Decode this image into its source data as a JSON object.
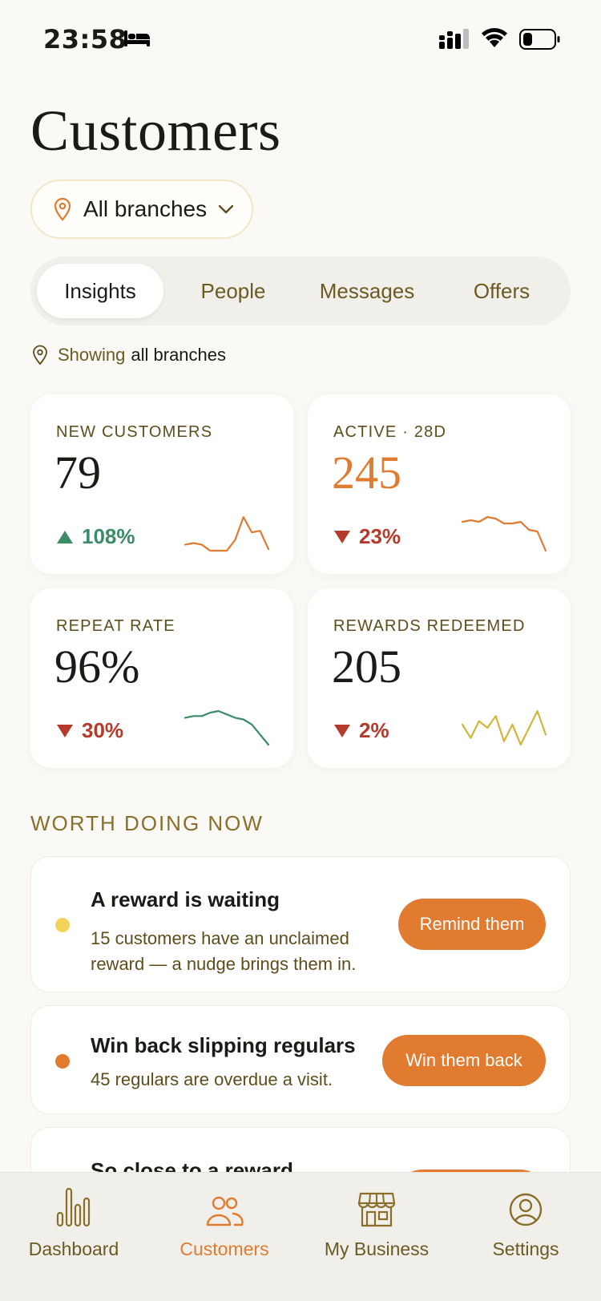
{
  "status_bar": {
    "time": "23:58",
    "icons": [
      "bed-icon",
      "signal-icon",
      "wifi-icon",
      "battery-icon"
    ]
  },
  "header": {
    "title": "Customers"
  },
  "branch_selector": {
    "value": "All branches",
    "icon": "location-pin-icon"
  },
  "tabs": [
    {
      "label": "Insights",
      "active": true
    },
    {
      "label": "People",
      "active": false
    },
    {
      "label": "Messages",
      "active": false
    },
    {
      "label": "Offers",
      "active": false
    }
  ],
  "showing": {
    "prefix": "Showing",
    "scope": "all branches"
  },
  "metrics": [
    {
      "label": "NEW CUSTOMERS",
      "value": "79",
      "delta": "108%",
      "direction": "up",
      "color": "#E07B30",
      "trend": [
        9,
        10,
        9,
        5,
        5,
        5,
        12,
        27,
        17,
        18,
        6
      ]
    },
    {
      "label": "ACTIVE · 28D",
      "value": "245",
      "delta": "23%",
      "direction": "down",
      "color": "#E07B30",
      "trend": [
        24,
        25,
        24,
        27,
        26,
        23,
        23,
        24,
        19,
        18,
        6
      ]
    },
    {
      "label": "REPEAT RATE",
      "value": "96%",
      "delta": "30%",
      "direction": "down",
      "color": "#3C8C68",
      "trend": [
        22,
        23,
        23,
        25,
        26,
        24,
        22,
        21,
        18,
        12,
        6
      ]
    },
    {
      "label": "REWARDS REDEEMED",
      "value": "205",
      "delta": "2%",
      "direction": "down",
      "color": "#D3B43C",
      "trend": [
        20,
        12,
        22,
        18,
        25,
        10,
        20,
        8,
        18,
        28,
        14
      ]
    }
  ],
  "colors": {
    "accent": "#E07B30",
    "positive": "#3C8C68",
    "negative": "#B43B2C",
    "warning": "#F2D45C"
  },
  "worth_doing": {
    "title": "WORTH DOING NOW",
    "items": [
      {
        "title": "A reward is waiting",
        "description_line1": "15 customers have an unclaimed",
        "description_line2": "reward — a nudge brings them in.",
        "button": "Remind them",
        "dot_color": "#F2D45C"
      },
      {
        "title": "Win back slipping regulars",
        "description_line1": "45 regulars are overdue a visit.",
        "button": "Win them back",
        "dot_color": "#E07B30"
      },
      {
        "title": "So close to a reward"
      }
    ]
  },
  "bottom_nav": [
    {
      "label": "Dashboard",
      "icon": "bar-chart-icon",
      "active": false
    },
    {
      "label": "Customers",
      "icon": "people-icon",
      "active": true
    },
    {
      "label": "My Business",
      "icon": "storefront-icon",
      "active": false
    },
    {
      "label": "Settings",
      "icon": "user-circle-icon",
      "active": false
    }
  ]
}
